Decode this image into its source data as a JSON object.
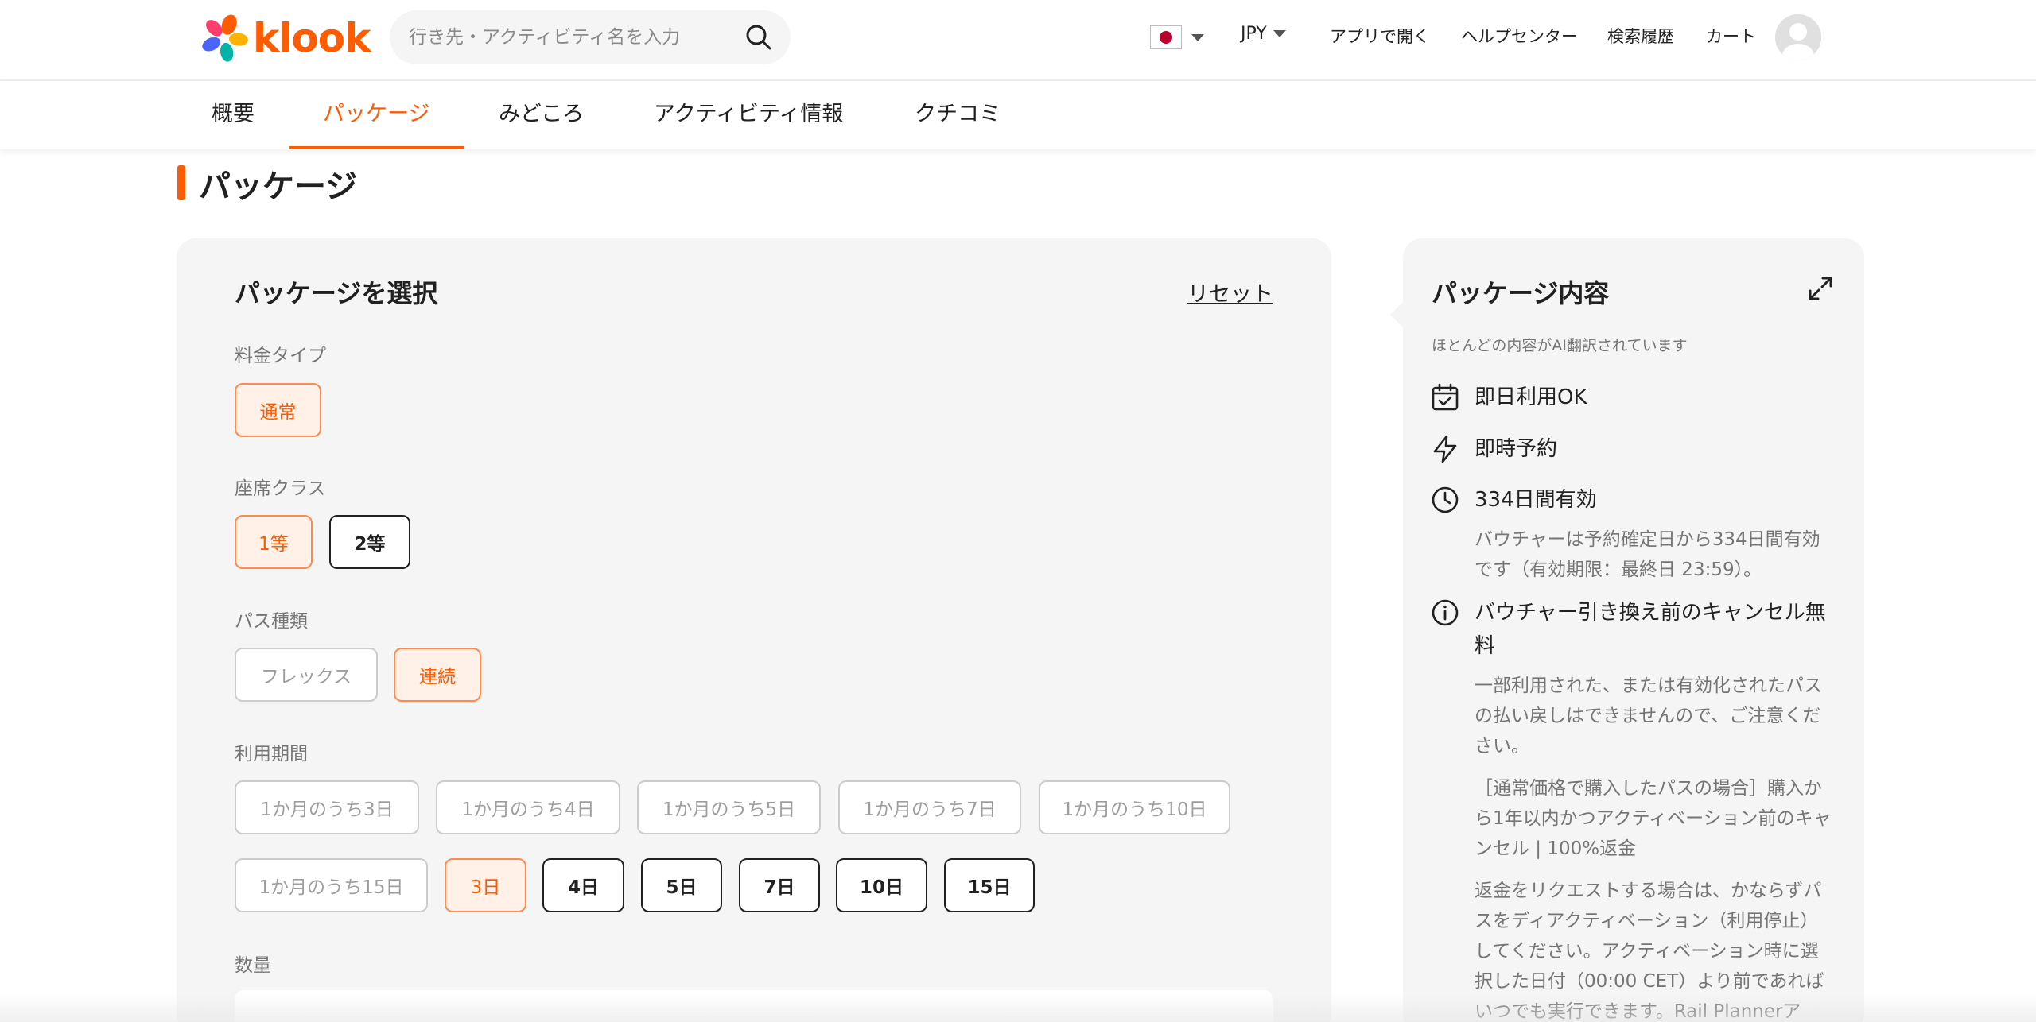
{
  "header": {
    "logo_text": "klook",
    "search_placeholder": "行き先・アクティビティ名を入力",
    "currency": "JPY",
    "links": [
      "アプリで開く",
      "ヘルプセンター",
      "検索履歴",
      "カート"
    ]
  },
  "tabs": [
    {
      "label": "概要",
      "active": false
    },
    {
      "label": "パッケージ",
      "active": true
    },
    {
      "label": "みどころ",
      "active": false
    },
    {
      "label": "アクティビティ情報",
      "active": false
    },
    {
      "label": "クチコミ",
      "active": false
    }
  ],
  "section_title": "パッケージ",
  "package_select": {
    "title": "パッケージを選択",
    "reset_label": "リセット",
    "groups": [
      {
        "label": "料金タイプ",
        "options": [
          {
            "label": "通常",
            "state": "selected"
          }
        ]
      },
      {
        "label": "座席クラス",
        "options": [
          {
            "label": "1等",
            "state": "selected"
          },
          {
            "label": "2等",
            "state": "normal"
          }
        ]
      },
      {
        "label": "パス種類",
        "options": [
          {
            "label": "フレックス",
            "state": "disabled"
          },
          {
            "label": "連続",
            "state": "selected"
          }
        ]
      },
      {
        "label": "利用期間",
        "options": [
          {
            "label": "1か月のうち3日",
            "state": "disabled"
          },
          {
            "label": "1か月のうち4日",
            "state": "disabled"
          },
          {
            "label": "1か月のうち5日",
            "state": "disabled"
          },
          {
            "label": "1か月のうち7日",
            "state": "disabled"
          },
          {
            "label": "1か月のうち10日",
            "state": "disabled"
          },
          {
            "label": "1か月のうち15日",
            "state": "disabled"
          },
          {
            "label": "3日",
            "state": "selected"
          },
          {
            "label": "4日",
            "state": "normal"
          },
          {
            "label": "5日",
            "state": "normal"
          },
          {
            "label": "7日",
            "state": "normal"
          },
          {
            "label": "10日",
            "state": "normal"
          },
          {
            "label": "15日",
            "state": "normal"
          }
        ]
      }
    ],
    "quantity_label": "数量"
  },
  "package_details": {
    "title": "パッケージ内容",
    "ai_note": "ほとんどの内容がAI翻訳されています",
    "features": [
      {
        "icon": "calendar-check-icon",
        "text": "即日利用OK"
      },
      {
        "icon": "lightning-icon",
        "text": "即時予約"
      },
      {
        "icon": "clock-icon",
        "text": "334日間有効",
        "desc": "バウチャーは予約確定日から334日間有効です（有効期限：最終日 23:59）。"
      },
      {
        "icon": "info-icon",
        "text": "バウチャー引き換え前のキャンセル無料",
        "desc": "一部利用された、または有効化されたパスの払い戻しはできませんので、ご注意ください。"
      }
    ],
    "refund_note": "［通常価格で購入したパスの場合］購入から1年以内かつアクティベーション前のキャンセル | 100%返金",
    "refund_request": "返金をリクエストする場合は、かならずパスをディアクティベーション（利用停止）してください。アクティベーション時に選択した日付（00:00 CET）より前であればいつでも実行できます。Rail Plannerア"
  },
  "colors": {
    "accent": "#ff5b00",
    "selected_bg": "#fff1e8",
    "card_bg": "#f5f5f5"
  }
}
